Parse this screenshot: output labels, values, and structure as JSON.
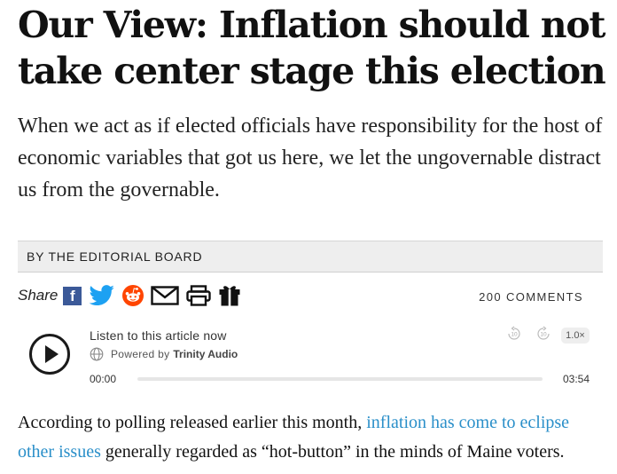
{
  "article": {
    "headline": "Our View: Inflation should not take center stage this election",
    "dek": "When we act as if elected officials have responsibility for the host of economic variables that got us here, we let the ungovernable distract us from the governable.",
    "byline": "BY THE EDITORIAL BOARD",
    "body": {
      "before_link": "According to polling released earlier this month, ",
      "link_text": "inflation has come to eclipse other issues",
      "after_link": " generally regarded as “hot-button” in the minds of Maine voters."
    }
  },
  "share": {
    "label": "Share",
    "icons": [
      "facebook-icon",
      "twitter-icon",
      "reddit-icon",
      "email-icon",
      "print-icon",
      "gift-icon"
    ],
    "facebook_letter": "f"
  },
  "comments": {
    "label": "200 COMMENTS"
  },
  "audio_player": {
    "title": "Listen to this article now",
    "powered_by_label": "Powered by",
    "powered_by_brand": "Trinity Audio",
    "current_time": "00:00",
    "duration": "03:54",
    "progress_fraction": 0,
    "skip_back_seconds": "10",
    "skip_forward_seconds": "10",
    "speed": "1.0×"
  },
  "colors": {
    "link": "#2a8fc9",
    "facebook": "#3b5998",
    "twitter": "#1da1f2",
    "reddit": "#ff4500",
    "byline_bar": "#eeeeee"
  }
}
